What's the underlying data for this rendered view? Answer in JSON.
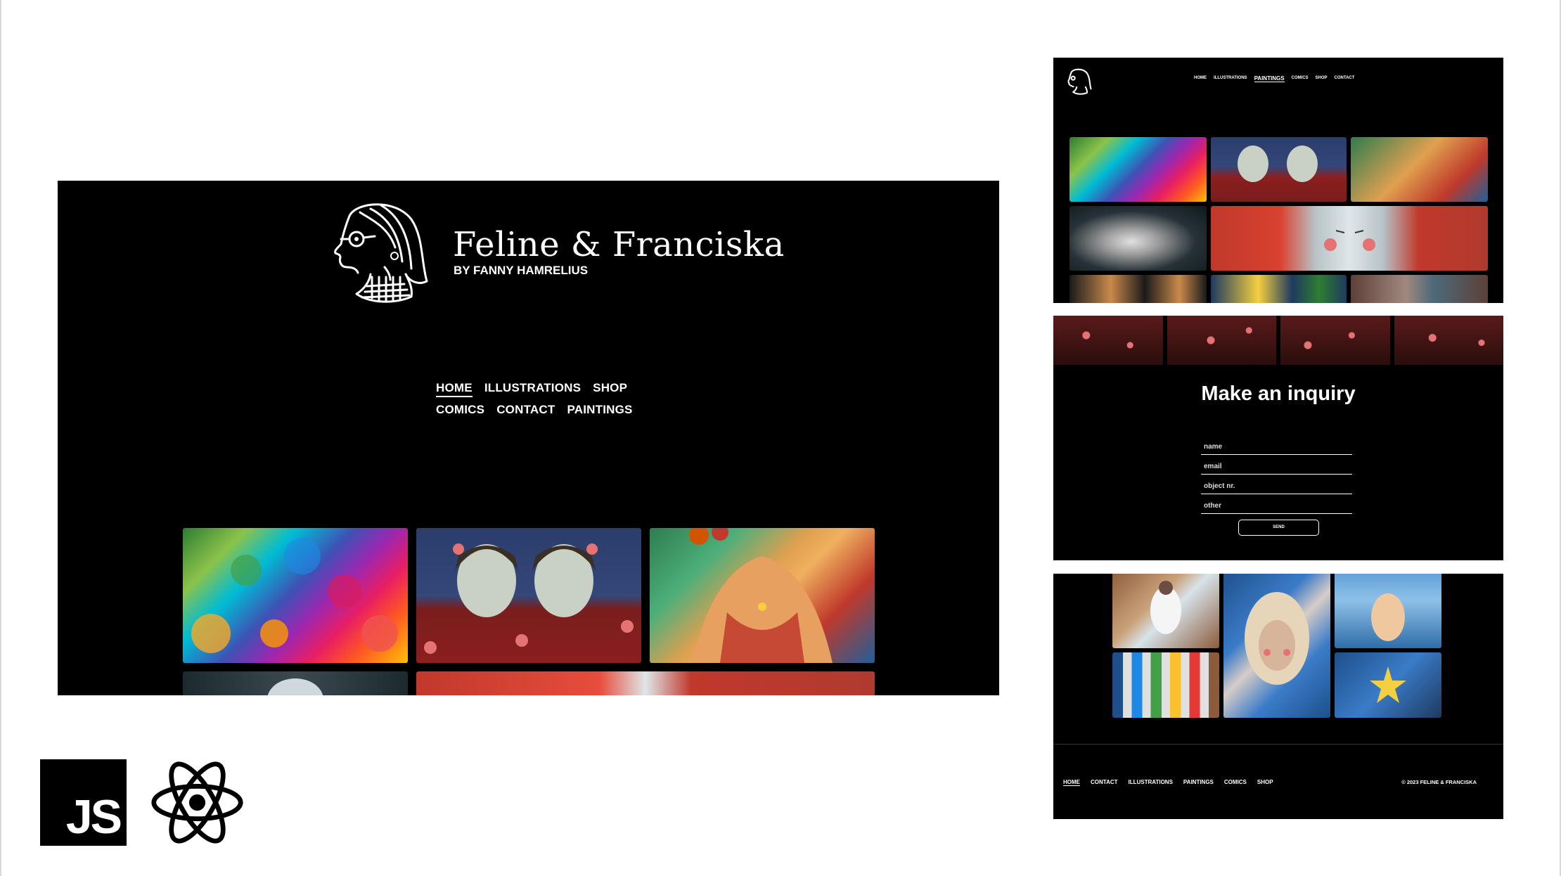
{
  "main": {
    "title": "Feline & Franciska",
    "subtitle": "BY FANNY HAMRELIUS",
    "nav_row1": [
      {
        "label": "HOME",
        "active": true
      },
      {
        "label": "ILLUSTRATIONS",
        "active": false
      },
      {
        "label": "SHOP",
        "active": false
      }
    ],
    "nav_row2": [
      {
        "label": "COMICS",
        "active": false
      },
      {
        "label": "CONTACT",
        "active": false
      },
      {
        "label": "PAINTINGS",
        "active": false
      }
    ]
  },
  "paintings_page": {
    "nav": [
      {
        "label": "HOME",
        "active": false
      },
      {
        "label": "ILLUSTRATIONS",
        "active": false
      },
      {
        "label": "PAINTINGS",
        "active": true
      },
      {
        "label": "COMICS",
        "active": false
      },
      {
        "label": "SHOP",
        "active": false
      },
      {
        "label": "CONTACT",
        "active": false
      }
    ]
  },
  "inquiry": {
    "title": "Make an inquiry",
    "fields": [
      {
        "placeholder": "name"
      },
      {
        "placeholder": "email"
      },
      {
        "placeholder": "object nr."
      },
      {
        "placeholder": "other"
      }
    ],
    "send_label": "SEND"
  },
  "footer": {
    "links": [
      {
        "label": "HOME",
        "active": true
      },
      {
        "label": "CONTACT",
        "active": false
      },
      {
        "label": "ILLUSTRATIONS",
        "active": false
      },
      {
        "label": "PAINTINGS",
        "active": false
      },
      {
        "label": "COMICS",
        "active": false
      },
      {
        "label": "SHOP",
        "active": false
      }
    ],
    "copyright": "© 2023 FELINE & FRANCISKA"
  },
  "tech": {
    "js_label": "JS",
    "react_icon": "react-atom-icon",
    "react_color": "#000000"
  },
  "colors": {
    "page_bg": "#000000",
    "text": "#ffffff"
  }
}
